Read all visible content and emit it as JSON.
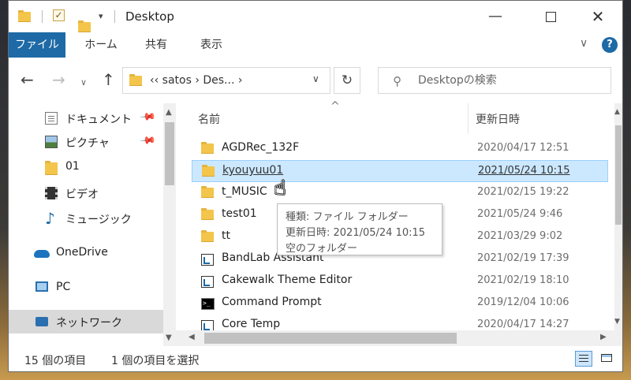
{
  "window": {
    "title": "Desktop",
    "controls": {
      "minimize": "—",
      "close": "✕"
    }
  },
  "quick_access": {
    "dropdown_glyph": "▾"
  },
  "ribbon": {
    "tabs": [
      {
        "label": "ファイル"
      },
      {
        "label": "ホーム"
      },
      {
        "label": "共有"
      },
      {
        "label": "表示"
      }
    ],
    "help_label": "?"
  },
  "nav": {
    "back": "←",
    "forward": "→",
    "recent_dropdown": "∨",
    "up": "↑",
    "address_path": "‹‹  satos  ›  Des...  ›",
    "address_dropdown": "∨",
    "refresh": "↻",
    "search_placeholder": "Desktopの検索"
  },
  "sidebar": {
    "items": [
      {
        "label": "ドキュメント",
        "icon": "document-icon",
        "pinned": true
      },
      {
        "label": "ピクチャ",
        "icon": "pictures-icon",
        "pinned": true
      },
      {
        "label": "01",
        "icon": "folder-icon",
        "pinned": false
      },
      {
        "label": "ビデオ",
        "icon": "video-icon",
        "pinned": false
      },
      {
        "label": "ミュージック",
        "icon": "music-icon",
        "pinned": false
      },
      {
        "label": "OneDrive",
        "icon": "cloud-icon",
        "pinned": false
      },
      {
        "label": "PC",
        "icon": "pc-icon",
        "pinned": false
      },
      {
        "label": "ネットワーク",
        "icon": "network-icon",
        "pinned": false,
        "selected": true
      }
    ]
  },
  "file_list": {
    "columns": {
      "name": "名前",
      "modified": "更新日時"
    },
    "sort_indicator": "^",
    "rows": [
      {
        "name": "AGDRec_132F",
        "modified": "2020/04/17 12:51",
        "type": "folder"
      },
      {
        "name": "kyouyuu01",
        "modified": "2021/05/24 10:15",
        "type": "folder",
        "selected": true
      },
      {
        "name": "t_MUSIC",
        "modified": "2021/02/15 19:22",
        "type": "folder"
      },
      {
        "name": "test01",
        "modified": "2021/05/24 9:46",
        "type": "folder"
      },
      {
        "name": "tt",
        "modified": "2021/03/29 9:02",
        "type": "folder"
      },
      {
        "name": "BandLab Assistant",
        "modified": "2021/02/19 17:39",
        "type": "shortcut"
      },
      {
        "name": "Cakewalk Theme Editor",
        "modified": "2021/02/19 18:10",
        "type": "shortcut"
      },
      {
        "name": "Command Prompt",
        "modified": "2019/12/04 10:06",
        "type": "cmd"
      },
      {
        "name": "Core Temp",
        "modified": "2020/04/17 14:27",
        "type": "shortcut"
      }
    ]
  },
  "tooltip": {
    "type_line": "種類: ファイル フォルダー",
    "modified_line": "更新日時: 2021/05/24 10:15",
    "content_line": "空のフォルダー"
  },
  "status": {
    "item_count": "15 個の項目",
    "selection": "1 個の項目を選択"
  },
  "scroll_glyphs": {
    "up": "▲",
    "down": "▼",
    "left": "◀",
    "right": "▶"
  }
}
